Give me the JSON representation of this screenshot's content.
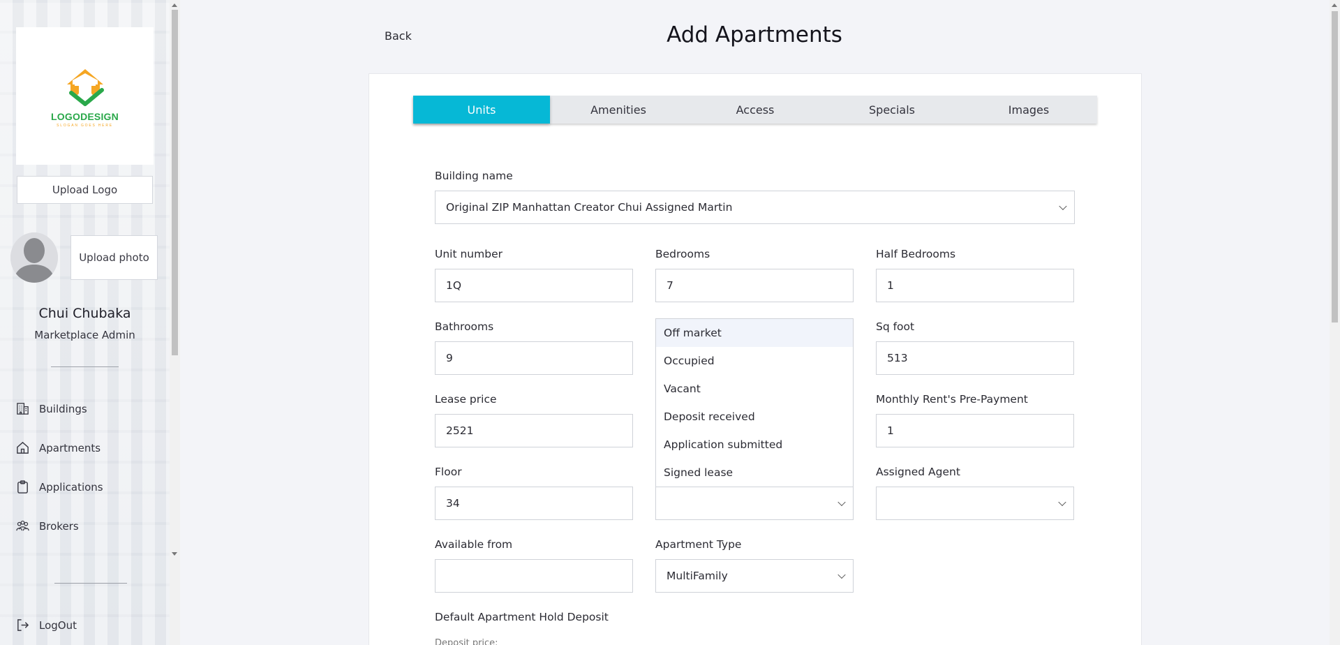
{
  "sidebar": {
    "logo": {
      "text": "LOGODESIGN",
      "tagline": "SLOGAN GOES HERE"
    },
    "upload_logo_label": "Upload Logo",
    "upload_photo_label": "Upload photo",
    "user": {
      "name": "Chui Chubaka",
      "role": "Marketplace Admin"
    },
    "nav": [
      {
        "label": "Buildings",
        "icon": "building-icon"
      },
      {
        "label": "Apartments",
        "icon": "home-icon"
      },
      {
        "label": "Applications",
        "icon": "clipboard-icon"
      },
      {
        "label": "Brokers",
        "icon": "people-icon"
      }
    ],
    "logout_label": "LogOut"
  },
  "header": {
    "back_label": "Back",
    "title": "Add Apartments"
  },
  "tabs": [
    {
      "label": "Units",
      "active": true
    },
    {
      "label": "Amenities",
      "active": false
    },
    {
      "label": "Access",
      "active": false
    },
    {
      "label": "Specials",
      "active": false
    },
    {
      "label": "Images",
      "active": false
    }
  ],
  "form": {
    "building_name": {
      "label": "Building name",
      "value": "Original ZIP Manhattan Creator Chui Assigned Martin"
    },
    "unit_number": {
      "label": "Unit number",
      "value": "1Q"
    },
    "bedrooms": {
      "label": "Bedrooms",
      "value": "7"
    },
    "half_bedrooms": {
      "label": "Half Bedrooms",
      "value": "1"
    },
    "bathrooms": {
      "label": "Bathrooms",
      "value": "9"
    },
    "sq_foot": {
      "label": "Sq foot",
      "value": "513"
    },
    "lease_price": {
      "label": "Lease price",
      "value": "2521"
    },
    "monthly_prepayment": {
      "label": "Monthly Rent's Pre-Payment",
      "value": "1"
    },
    "floor": {
      "label": "Floor",
      "value": "34"
    },
    "status": {
      "value": ""
    },
    "assigned_agent": {
      "label": "Assigned Agent",
      "value": ""
    },
    "available_from": {
      "label": "Available from",
      "value": ""
    },
    "apartment_type": {
      "label": "Apartment Type",
      "value": "MultiFamily"
    },
    "hold_deposit": {
      "label": "Default Apartment Hold Deposit",
      "sublabel": "Deposit price:"
    }
  },
  "status_dropdown": {
    "options": [
      "Off market",
      "Occupied",
      "Vacant",
      "Deposit received",
      "Application submitted",
      "Signed lease"
    ],
    "highlighted_index": 0
  },
  "colors": {
    "accent": "#06b8d6",
    "background": "#f3f4f8"
  }
}
